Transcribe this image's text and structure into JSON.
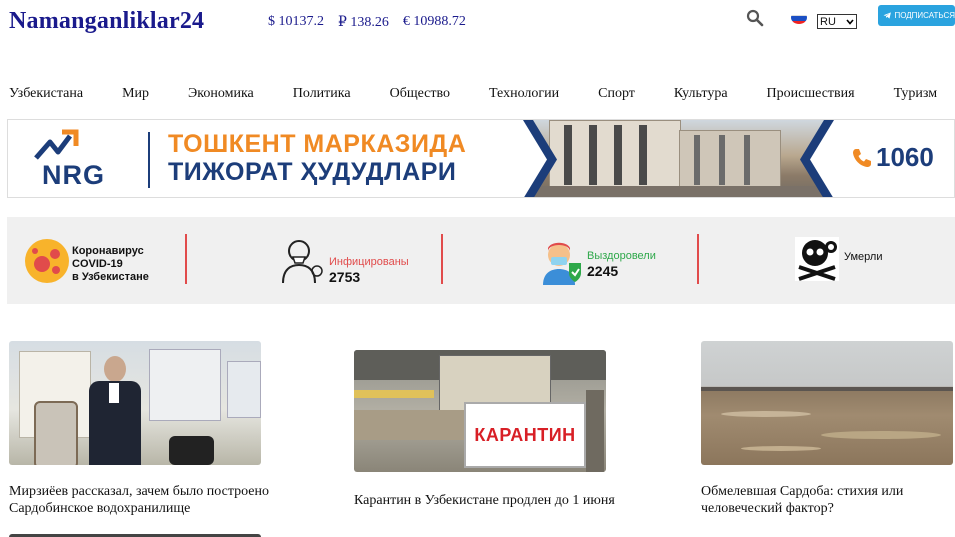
{
  "header": {
    "logo": "Namanganliklar24",
    "rates": [
      {
        "symbol": "$",
        "value": "10137.2"
      },
      {
        "symbol": "₽",
        "value": "138.26"
      },
      {
        "symbol": "€",
        "value": "10988.72"
      }
    ],
    "language": "RU",
    "telegram_label": "ПОДПИСАТЬСЯ"
  },
  "nav": [
    "Узбекистана",
    "Мир",
    "Экономика",
    "Политика",
    "Общество",
    "Технологии",
    "Спорт",
    "Культура",
    "Происшествия",
    "Туризм"
  ],
  "banner": {
    "brand": "NRG",
    "line1": "ТОШКЕНТ МАРКАЗИДА",
    "line2": "ТИЖОРАТ ҲУДУДЛАРИ",
    "phone": "1060",
    "colors": {
      "navy": "#1c3d7a",
      "orange": "#f08a24"
    }
  },
  "covid": {
    "title_lines": [
      "Коронавирус",
      "COVID-19",
      "в Узбекистане"
    ],
    "infected_label": "Инфицированы",
    "infected_count": "2753",
    "recovered_label": "Выздоровели",
    "recovered_count": "2245",
    "deaths_label": "Умерли",
    "colors": {
      "infected": "#e14b4b",
      "recovered": "#2ea84a"
    }
  },
  "news": [
    {
      "title": "Мирзиёев рассказал, зачем было построено Сардобинское водохранилище"
    },
    {
      "title": "Карантин в Узбекистане продлен до 1 июня",
      "sign_text": "КАРАНТИН"
    },
    {
      "title": "Обмелевшая Сардоба: стихия или человеческий фактор?"
    }
  ]
}
